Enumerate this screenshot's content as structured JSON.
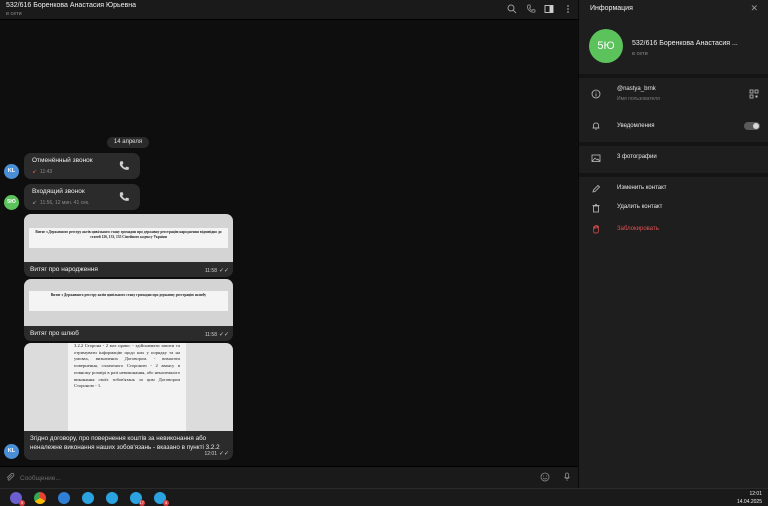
{
  "chat": {
    "title": "532/616 Боренкова Анастасия Юрьевна",
    "status": "в сети",
    "date_label": "14 апреля",
    "composer_placeholder": "Сообщение..."
  },
  "messages": {
    "missed_call": {
      "avatar": "KL",
      "title": "Отменённый звонок",
      "time": "11:43"
    },
    "incoming_call": {
      "avatar": "5Ю",
      "title": "Входящий звонок",
      "meta": "11:56, 12 мин. 41 сек."
    },
    "birth_doc": {
      "doc_text": "Витяг з Державного реєстру актів цивільного стану громадян про державну реєстрацію народження відповідно до статей 126, 133, 135 Сімейного кодексу України",
      "caption": "Витяг про народження",
      "time": "11:58"
    },
    "marriage_doc": {
      "doc_text": "Витяг з Державного реєстру актів цивільного стану громадян про державну реєстрацію шлюбу",
      "caption": "Витяг про шлюб",
      "time": "11:58"
    },
    "contract": {
      "avatar": "KL",
      "doc_text": "3.2.2 Сторона - 2 має право: - здійснювати запити та отримувати інформацію щодо них у порядку та на умовах, визначених Договором. - вимагати повернення, сплаченого Стороною - 2 авансу в повному розмірі в разі невиконання, або неналежного виконання своїх зобов'язань за цим Договором Стороною - 1.",
      "caption": "Згідно договору, про повернення коштів за невиконання або неналежне виконання наших зобов'язань - вказано в пункті 3.2.2",
      "time": "12:01"
    }
  },
  "info": {
    "header": "Информация",
    "avatar": "5Ю",
    "name": "532/616 Боренкова Анастасия ...",
    "status": "в сети",
    "username": "@nastya_brnk",
    "username_label": "Имя пользователя",
    "notifications": "Уведомления",
    "photos": "3 фотографии",
    "edit_contact": "Изменить контакт",
    "delete_contact": "Удалить контакт",
    "block": "Заблокировать"
  },
  "taskbar": {
    "time": "12:01",
    "date": "14.04.2025",
    "badges": {
      "app1": "9",
      "tg3": "17",
      "tg4": "4"
    }
  },
  "colors": {
    "accent_green": "#5cc25c",
    "accent_blue": "#4a8fd6",
    "danger": "#e05050",
    "bubble": "#2b2b2b"
  }
}
